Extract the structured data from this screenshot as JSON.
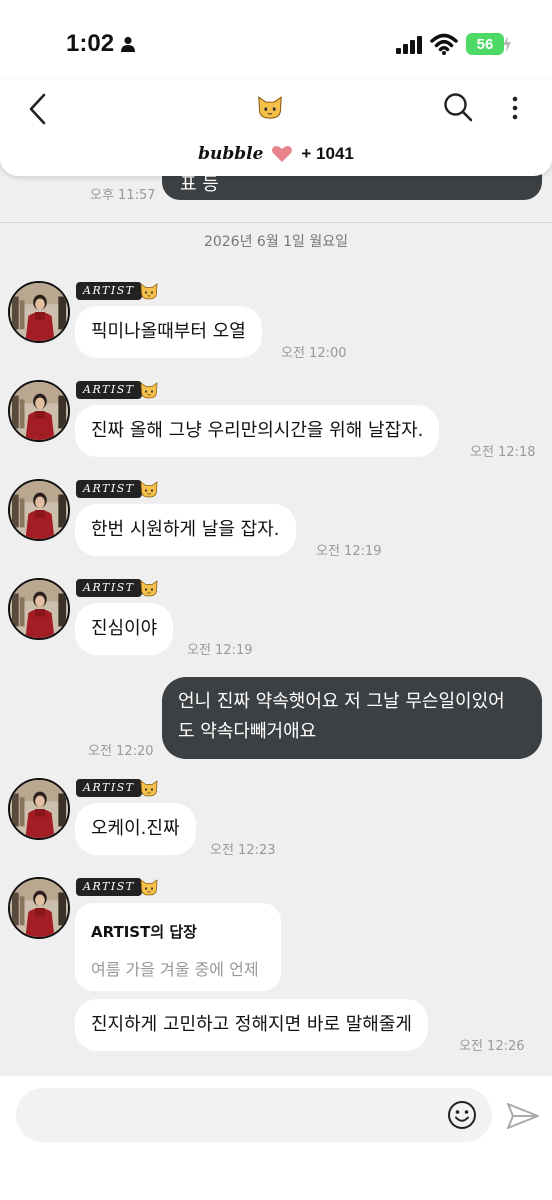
{
  "status_bar": {
    "time": "1:02",
    "battery": "56"
  },
  "header": {
    "brand": "bubble",
    "count": "+ 1041",
    "title_icon": "cat-emoji-icon"
  },
  "previous": {
    "partial_text": "표 등",
    "time": "오후 11:57"
  },
  "date_divider": "2026년 6월 1일 월요일",
  "artist_tag": "ARTIST",
  "messages": [
    {
      "text": "픽미나올때부터 오열",
      "time": "오전 12:00"
    },
    {
      "text": "진짜 올해 그냥 우리만의시간을 위해 날잡자.",
      "time": "오전 12:18"
    },
    {
      "text": "한번 시원하게 날을 잡자.",
      "time": "오전 12:19"
    },
    {
      "text": "진심이야",
      "time": "오전 12:19"
    },
    {
      "text": "오케이.진짜",
      "time": "오전 12:23"
    },
    {
      "text": "진지하게 고민하고 정해지면 바로 말해줄게",
      "time": "오전 12:26"
    }
  ],
  "outgoing": {
    "line1": "언니 진짜 약속햇어요 저 그날 무슨일이있어",
    "line2": "도 약속다빼거애요",
    "time": "오전 12:20"
  },
  "reply": {
    "title": "ARTIST의 답장",
    "quote": "여름 가을 겨울 중에 언제"
  },
  "input": {
    "placeholder": ""
  },
  "colors": {
    "outgoing_bubble": "#3d4043",
    "background": "#efefef",
    "battery": "#4cd964",
    "heart": "#e8838c"
  }
}
